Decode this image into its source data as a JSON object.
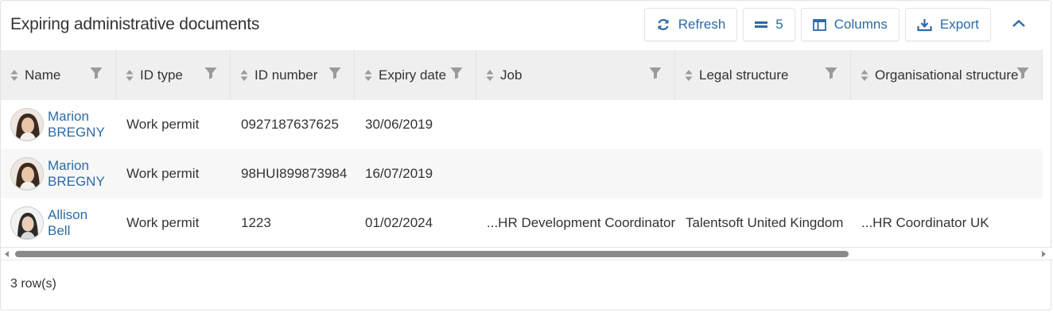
{
  "panel": {
    "title": "Expiring administrative documents",
    "toolbar": {
      "refresh_label": "Refresh",
      "rows_label": "5",
      "columns_label": "Columns",
      "export_label": "Export"
    }
  },
  "columns": [
    "Name",
    "ID type",
    "ID number",
    "Expiry date",
    "Job",
    "Legal structure",
    "Organisational structure"
  ],
  "rows": [
    {
      "first": "Marion",
      "last": "BREGNY",
      "id_type": "Work permit",
      "id_number": "0927187637625",
      "expiry": "30/06/2019",
      "job": "",
      "legal": "",
      "org": ""
    },
    {
      "first": "Marion",
      "last": "BREGNY",
      "id_type": "Work permit",
      "id_number": "98HUI899873984",
      "expiry": "16/07/2019",
      "job": "",
      "legal": "",
      "org": ""
    },
    {
      "first": "Allison",
      "last": "Bell",
      "id_type": "Work permit",
      "id_number": "1223",
      "expiry": "01/02/2024",
      "job": "...HR Development Coordinator",
      "legal": "Talentsoft United Kingdom",
      "org": "...HR Coordinator UK"
    }
  ],
  "footer": {
    "row_count": "3 row(s)"
  },
  "icons": {
    "refresh": "refresh-icon",
    "rows": "rows-icon",
    "columns": "columns-icon",
    "export": "export-icon",
    "collapse": "chevron-up-icon",
    "sort": "sort-icon",
    "filter": "filter-icon"
  },
  "colors": {
    "accent": "#2d6aa6",
    "header_bg": "#efefef",
    "alt_row": "#f7f7f7"
  }
}
